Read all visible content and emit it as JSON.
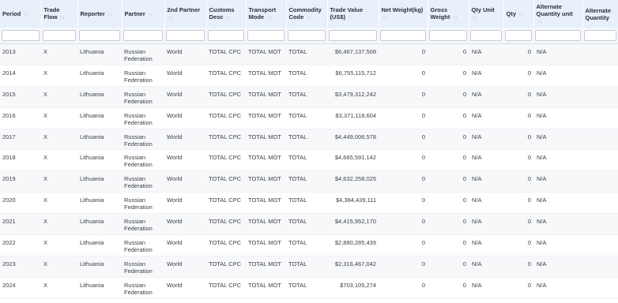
{
  "table": {
    "sort_glyph": "↑↓",
    "columns": [
      {
        "label": "Period"
      },
      {
        "label": "Trade Flow"
      },
      {
        "label": "Reporter"
      },
      {
        "label": "Partner"
      },
      {
        "label": "2nd Partner"
      },
      {
        "label": "Customs Desc"
      },
      {
        "label": "Transport Mode"
      },
      {
        "label": "Commodity Code"
      },
      {
        "label": "Trade Value (US$)"
      },
      {
        "label": "Net Weight(kg)"
      },
      {
        "label": "Gross Weight"
      },
      {
        "label": "Qty Unit"
      },
      {
        "label": "Qty"
      },
      {
        "label": "Alternate Quantity unit"
      },
      {
        "label": "Alternate Quantity"
      }
    ],
    "rows": [
      [
        "2013",
        "X",
        "Lithuania",
        "Russian Federation",
        "World",
        "TOTAL CPC",
        "TOTAL MOT",
        "TOTAL",
        "$6,467,137,508",
        "0",
        "0",
        "N/A",
        "0",
        "N/A",
        ""
      ],
      [
        "2014",
        "X",
        "Lithuania",
        "Russian Federation",
        "World",
        "TOTAL CPC",
        "TOTAL MOT",
        "TOTAL",
        "$6,755,115,712",
        "0",
        "0",
        "N/A",
        "0",
        "N/A",
        ""
      ],
      [
        "2015",
        "X",
        "Lithuania",
        "Russian Federation",
        "World",
        "TOTAL CPC",
        "TOTAL MOT",
        "TOTAL",
        "$3,479,312,242",
        "0",
        "0",
        "N/A",
        "0",
        "N/A",
        ""
      ],
      [
        "2016",
        "X",
        "Lithuania",
        "Russian Federation",
        "World",
        "TOTAL CPC",
        "TOTAL MOT",
        "TOTAL",
        "$3,371,118,604",
        "0",
        "0",
        "N/A",
        "0",
        "N/A",
        ""
      ],
      [
        "2017",
        "X",
        "Lithuania",
        "Russian Federation",
        "World",
        "TOTAL CPC",
        "TOTAL MOT",
        "TOTAL",
        "$4,449,006,578",
        "0",
        "0",
        "N/A",
        "0",
        "N/A",
        ""
      ],
      [
        "2018",
        "X",
        "Lithuania",
        "Russian Federation",
        "World",
        "TOTAL CPC",
        "TOTAL MOT",
        "TOTAL",
        "$4,665,591,142",
        "0",
        "0",
        "N/A",
        "0",
        "N/A",
        ""
      ],
      [
        "2019",
        "X",
        "Lithuania",
        "Russian Federation",
        "World",
        "TOTAL CPC",
        "TOTAL MOT",
        "TOTAL",
        "$4,632,258,025",
        "0",
        "0",
        "N/A",
        "0",
        "N/A",
        ""
      ],
      [
        "2020",
        "X",
        "Lithuania",
        "Russian Federation",
        "World",
        "TOTAL CPC",
        "TOTAL MOT",
        "TOTAL",
        "$4,384,439,111",
        "0",
        "0",
        "N/A",
        "0",
        "N/A",
        ""
      ],
      [
        "2021",
        "X",
        "Lithuania",
        "Russian Federation",
        "World",
        "TOTAL CPC",
        "TOTAL MOT",
        "TOTAL",
        "$4,415,952,170",
        "0",
        "0",
        "N/A",
        "0",
        "N/A",
        ""
      ],
      [
        "2022",
        "X",
        "Lithuania",
        "Russian Federation",
        "World",
        "TOTAL CPC",
        "TOTAL MOT",
        "TOTAL",
        "$2,880,285,439",
        "0",
        "0",
        "N/A",
        "0",
        "N/A",
        ""
      ],
      [
        "2023",
        "X",
        "Lithuania",
        "Russian Federation",
        "World",
        "TOTAL CPC",
        "TOTAL MOT",
        "TOTAL",
        "$2,316,467,042",
        "0",
        "0",
        "N/A",
        "0",
        "N/A",
        ""
      ],
      [
        "2024",
        "X",
        "Lithuania",
        "Russian Federation",
        "World",
        "TOTAL CPC",
        "TOTAL MOT",
        "TOTAL",
        "$703,105,274",
        "0",
        "0",
        "N/A",
        "0",
        "N/A",
        ""
      ]
    ]
  }
}
